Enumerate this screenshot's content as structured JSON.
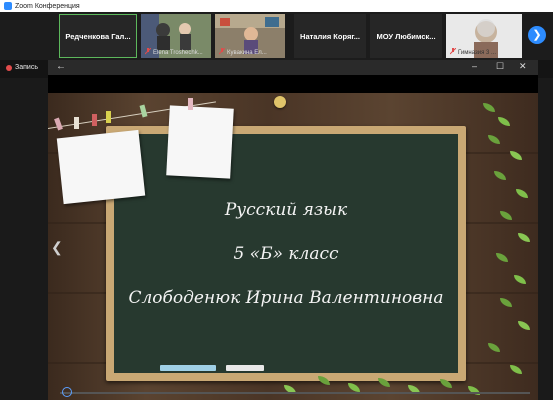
{
  "app": {
    "title": "Zoom Конференция",
    "icon": "zoom-logo-icon"
  },
  "participants": [
    {
      "type": "name",
      "name": "Редченкова Гал...",
      "muted": true,
      "selected": true
    },
    {
      "type": "video",
      "name": "Elena Troshechk...",
      "muted": true
    },
    {
      "type": "video",
      "name": "Кувакина Ел...",
      "muted": true
    },
    {
      "type": "name",
      "name": "Наталия Коряг...",
      "muted": true
    },
    {
      "type": "name",
      "name": "МОУ Любимск...",
      "muted": true
    },
    {
      "type": "video",
      "name": "Гимназия 3 ...",
      "muted": true
    }
  ],
  "next_page_icon": "chevron-right-icon",
  "recording": {
    "label": "Запись"
  },
  "window_controls": {
    "back": "←",
    "minimize": "–",
    "maximize": "☐",
    "close": "✕"
  },
  "slide": {
    "line1": "Русский язык",
    "line2": "5 «Б» класс",
    "line3": "Слободенюк Ирина Валентиновна"
  },
  "colors": {
    "accent": "#2d8cff",
    "board": "#27392f",
    "frame": "#c9a874",
    "rec": "#e14b4b",
    "speaker": "#5db85c"
  }
}
